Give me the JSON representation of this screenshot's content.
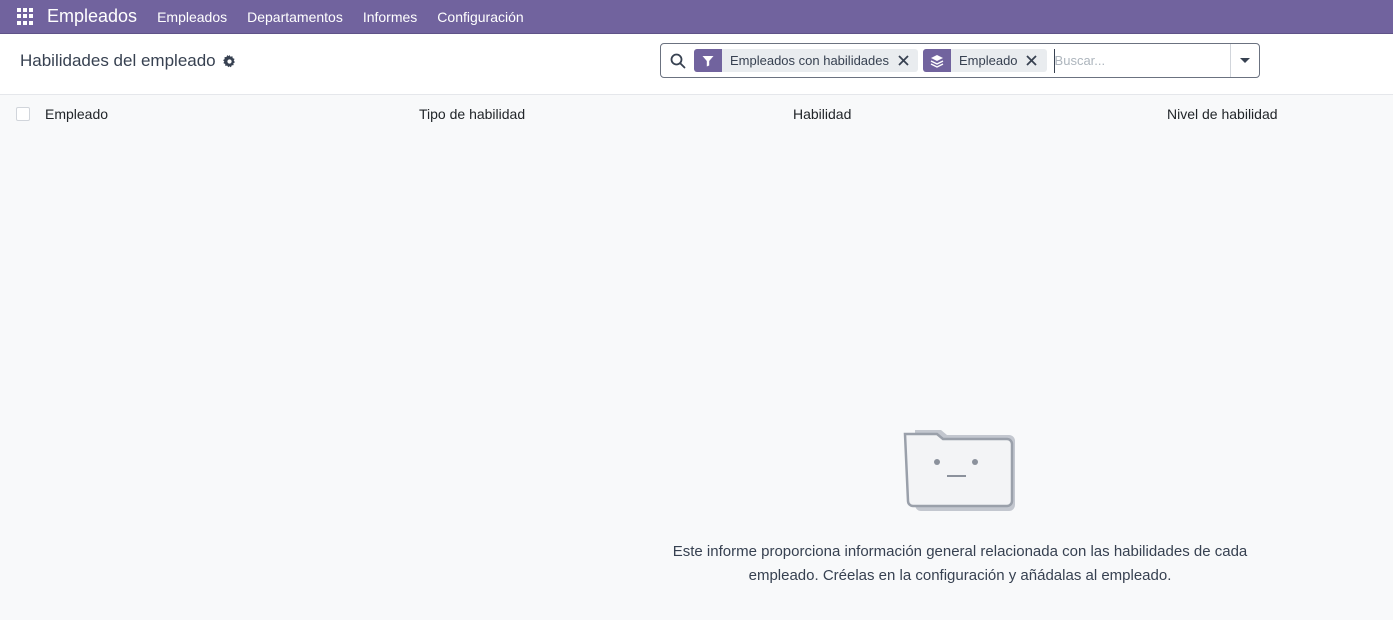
{
  "navbar": {
    "app_name": "Empleados",
    "menu": [
      "Empleados",
      "Departamentos",
      "Informes",
      "Configuración"
    ]
  },
  "control_panel": {
    "title": "Habilidades del empleado",
    "search": {
      "placeholder": "Buscar...",
      "facets": [
        {
          "type": "filter",
          "icon": "filter-icon",
          "label": "Empleados con habilidades"
        },
        {
          "type": "groupby",
          "icon": "layers-icon",
          "label": "Empleado"
        }
      ]
    }
  },
  "list": {
    "columns": [
      "Empleado",
      "Tipo de habilidad",
      "Habilidad",
      "Nivel de habilidad"
    ]
  },
  "empty_state": {
    "icon": "empty-folder-icon",
    "message_line1": "Este informe proporciona información general relacionada con las habilidades de cada",
    "message_line2": "empleado. Créelas en la configuración y añádalas al empleado."
  },
  "colors": {
    "brand": "#71639e",
    "background": "#f8f9fa"
  }
}
